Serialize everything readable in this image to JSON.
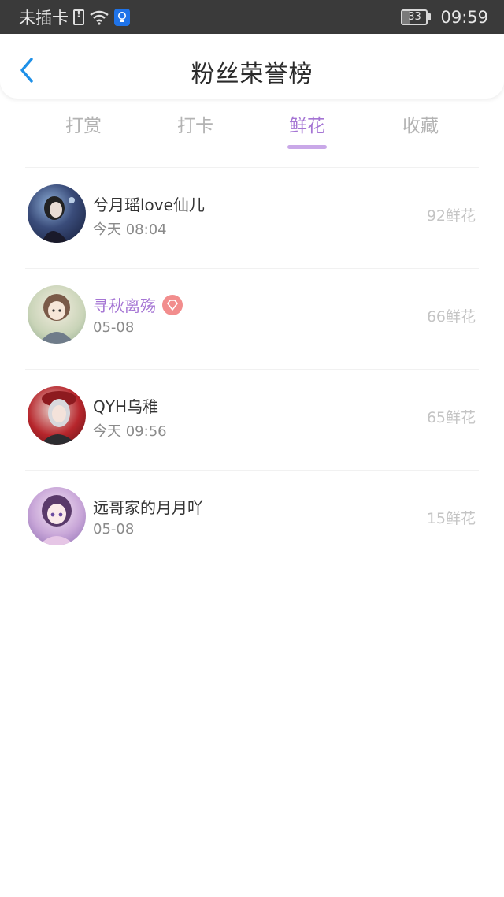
{
  "status_bar": {
    "carrier": "未插卡",
    "battery": "33",
    "battery_level": 0.33,
    "time": "09:59",
    "icons": [
      "sim-alert-icon",
      "wifi-icon",
      "bulb-icon",
      "battery-icon"
    ]
  },
  "header": {
    "title": "粉丝荣誉榜",
    "back_icon": "chevron-left-icon"
  },
  "tabs": [
    {
      "label": "打赏",
      "active": false
    },
    {
      "label": "打卡",
      "active": false
    },
    {
      "label": "鲜花",
      "active": true
    },
    {
      "label": "收藏",
      "active": false
    }
  ],
  "colors": {
    "accent": "#a575d4",
    "underline": "#c9a8e8",
    "vip_badge": "#f28d8d",
    "back_icon": "#1e90e8"
  },
  "fans": [
    {
      "name": "兮月瑶love仙儿",
      "time": "今天 08:04",
      "score": "92鲜花",
      "vip": false
    },
    {
      "name": "寻秋离殇",
      "time": "05-08",
      "score": "66鲜花",
      "vip": true
    },
    {
      "name": "QYH乌稚",
      "time": "今天 09:56",
      "score": "65鲜花",
      "vip": false
    },
    {
      "name": "远哥家的月月吖",
      "time": "05-08",
      "score": "15鲜花",
      "vip": false
    }
  ]
}
